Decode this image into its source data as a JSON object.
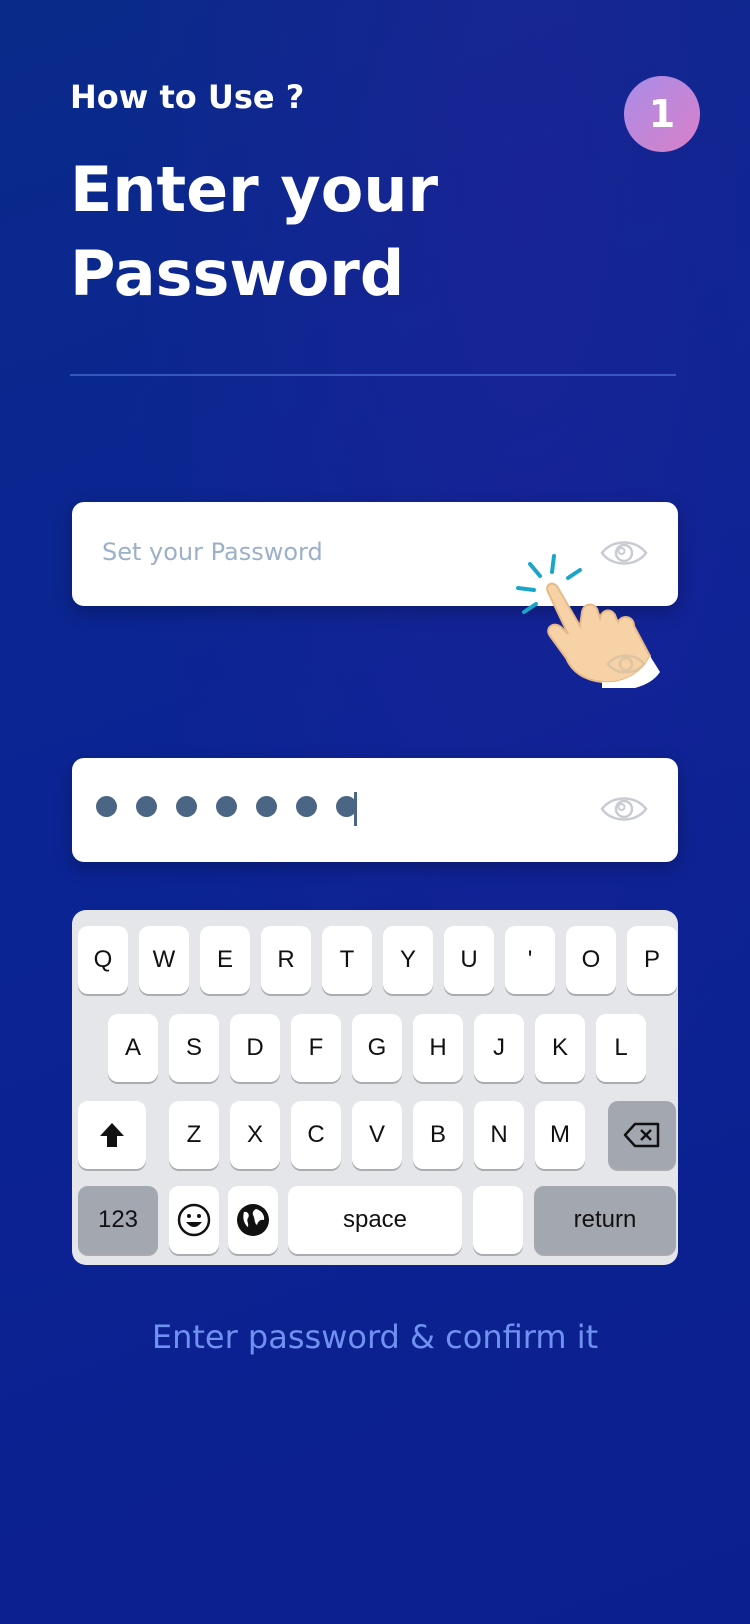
{
  "header": {
    "subtitle": "How to Use ?",
    "title": "Enter your Password",
    "step_number": "1"
  },
  "password_field": {
    "placeholder": "Set your Password",
    "icon": "eye-icon"
  },
  "confirm_field": {
    "masked_count": 7,
    "icon": "eye-icon"
  },
  "keyboard": {
    "row1": [
      "Q",
      "W",
      "E",
      "R",
      "T",
      "Y",
      "U",
      "'",
      "O",
      "P"
    ],
    "row2": [
      "A",
      "S",
      "D",
      "F",
      "G",
      "H",
      "J",
      "K",
      "L"
    ],
    "row3": [
      "Z",
      "X",
      "C",
      "V",
      "B",
      "N",
      "M"
    ],
    "numbers_label": "123",
    "space_label": "space",
    "return_label": "return",
    "shift_icon": "shift-icon",
    "backspace_icon": "backspace-icon",
    "emoji_icon": "emoji-icon",
    "globe_icon": "globe-icon"
  },
  "caption": "Enter password & confirm it",
  "colors": {
    "background": "#0b2494",
    "accent_text": "#6f92f0",
    "badge_from": "#a98ce8",
    "badge_to": "#d980c8",
    "tap_lines": "#1aa6c8"
  }
}
